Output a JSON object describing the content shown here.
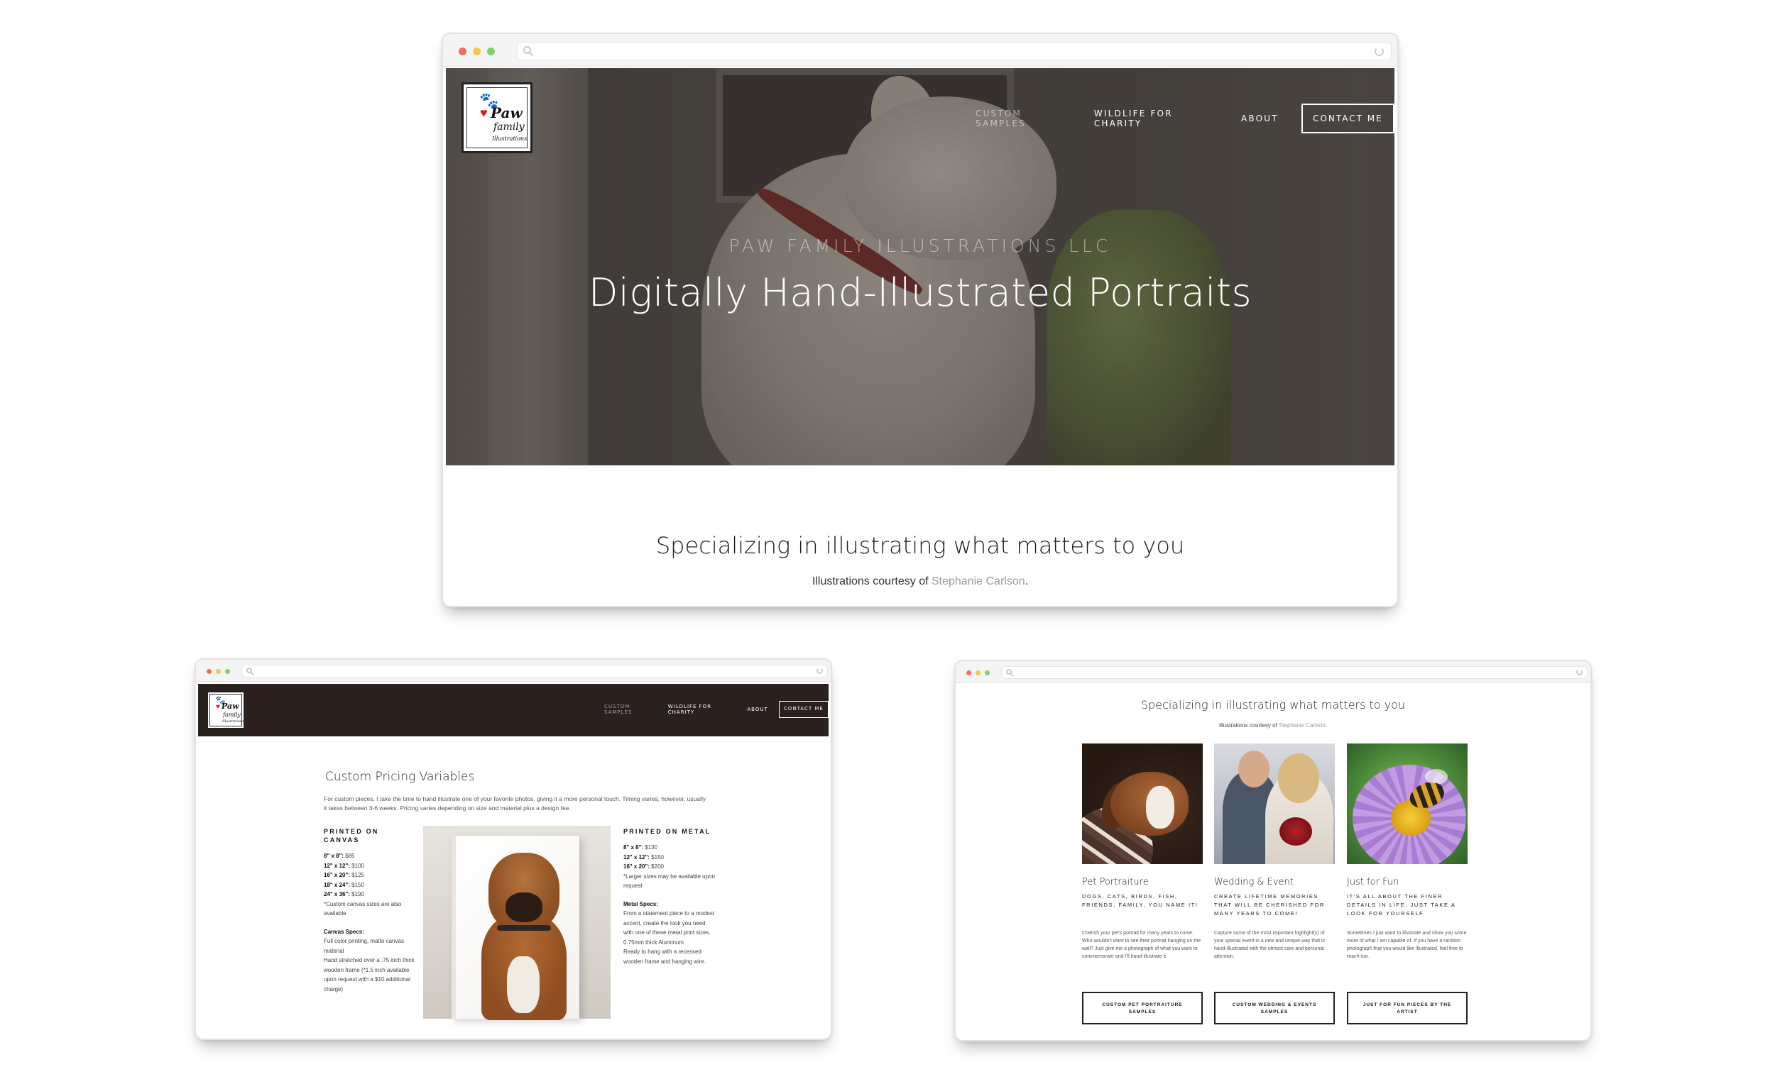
{
  "brand": {
    "logo_line1": "Paw",
    "logo_line2": "family",
    "logo_line3": "Illustrations"
  },
  "nav": {
    "items": [
      "CUSTOM SAMPLES",
      "WILDLIFE FOR CHARITY",
      "ABOUT"
    ],
    "cta": "CONTACT ME"
  },
  "home": {
    "eyebrow": "PAW FAMILY ILLUSTRATIONS LLC",
    "title": "Digitally Hand-Illustrated Portraits",
    "tagline": "Specializing in illustrating what matters to you",
    "courtesy_prefix": "Illustrations courtesy of ",
    "courtesy_artist": "Stephanie Carlson",
    "courtesy_suffix": "."
  },
  "pricing": {
    "title": "Custom Pricing Variables",
    "intro": "For custom pieces, I take the time to hand illustrate one of your favorite photos, giving it a more personal touch. Timing varies, however, usually it takes between 3-6 weeks. Pricing varies depending on size and material plus a design fee.",
    "canvas": {
      "heading": "PRINTED ON CANVAS",
      "prices": [
        {
          "size": "8\" x 8\":",
          "price": " $85"
        },
        {
          "size": "12\" x 12\":",
          "price": " $100"
        },
        {
          "size": "16\" x 20\":",
          "price": " $125"
        },
        {
          "size": "18\" x 24\":",
          "price": " $150"
        },
        {
          "size": "24\" x 36\":",
          "price": " $190"
        }
      ],
      "note": "*Custom canvas sizes are also available",
      "specs_heading": "Canvas Specs:",
      "specs": [
        "Full color printing, matte canvas material",
        "Hand stretched over a .75 inch thick wooden frame (*1.5 inch available upon request with a $10 additional charge)"
      ]
    },
    "metal": {
      "heading": "PRINTED ON METAL",
      "prices": [
        {
          "size": "8\" x 8\":",
          "price": " $130"
        },
        {
          "size": "12\" x 12\":",
          "price": " $150"
        },
        {
          "size": "16\" x 20\":",
          "price": " $200"
        }
      ],
      "note": "*Larger sizes may be available upon request",
      "specs_heading": "Metal Specs:",
      "specs": [
        "From a statement piece to a modest accent, create the look you need with one of these metal print sizes.",
        "0.75mm thick Aluminum",
        "Ready to hang with a recessed wooden frame and hanging wire."
      ]
    }
  },
  "samples": {
    "tagline": "Specializing in illustrating what matters to you",
    "courtesy_prefix": "Illustrations courtesy of ",
    "courtesy_artist": "Stephanie Carlson",
    "courtesy_suffix": ".",
    "cards": [
      {
        "title": "Pet Portraiture",
        "subtitle": "DOGS, CATS, BIRDS, FISH, FRIENDS, FAMILY, YOU NAME IT!",
        "body": "Cherish your pet's portrait for many years to come. Who wouldn't want to see their portrait hanging on the wall? Just give me a photograph of what you want to commemorate and I'll hand-illustrate it.",
        "button": "CUSTOM PET PORTRAITURE SAMPLES"
      },
      {
        "title": "Wedding & Event",
        "subtitle": "CREATE LIFETIME MEMORIES THAT WILL BE CHERISHED FOR MANY YEARS TO COME!",
        "body": "Capture some of the most important highlight(s) of your special event in a new and unique way that is hand-illustrated with the utmost care and personal attention.",
        "button": "CUSTOM WEDDING & EVENTS SAMPLES"
      },
      {
        "title": "Just for Fun",
        "subtitle": "IT'S ALL ABOUT THE FINER DETAILS IN LIFE, JUST TAKE A LOOK FOR YOURSELF.",
        "body": "Sometimes I just want to illustrate and show you some more of what I am capable of. If you have a random photograph that you would like illustrated, feel free to reach out.",
        "button": "JUST FOR FUN PIECES BY THE ARTIST"
      }
    ]
  },
  "colors": {
    "accent_dark": "#2a211f",
    "muted_link": "#9a9a9a",
    "logo_heart": "#cc1f2b"
  }
}
